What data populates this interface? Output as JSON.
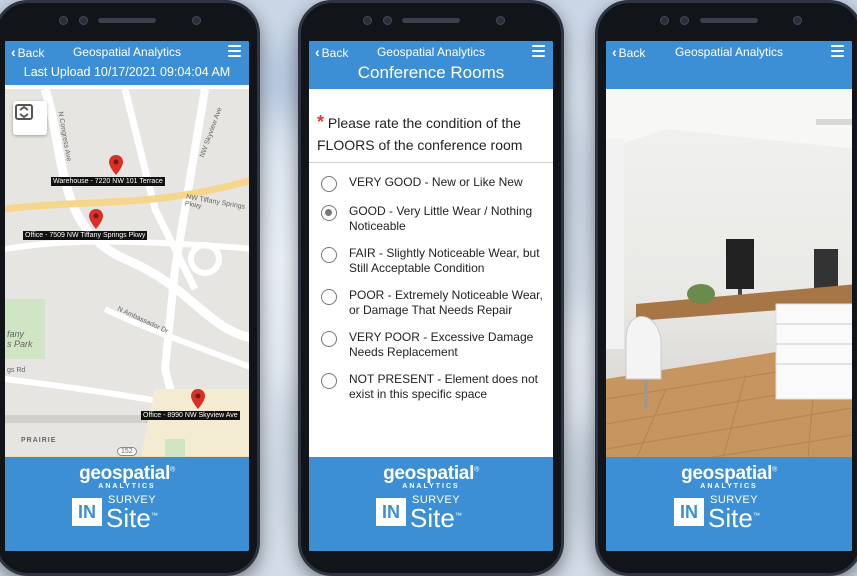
{
  "phones": [
    {
      "header": {
        "back_label": "Back",
        "app_title": "Geospatial Analytics",
        "subtitle": "Last Upload 10/17/2021 09:04:04 AM"
      },
      "map": {
        "pins": [
          {
            "label": "Warehouse - 7220 NW 101 Terrace"
          },
          {
            "label": "Office - 7509 NW Tiffany Springs Pkwy"
          },
          {
            "label": "Office - 8990 NW Skyview Ave"
          }
        ],
        "streets": [
          "N Congress Ave",
          "NW Skyview Ave",
          "N Ambassador Dr",
          "NW Tiffany Springs Pkwy",
          "fany\ns Park",
          "gs Rd",
          "PRAIRIE",
          "152"
        ],
        "icons": [
          "expand-map-icon"
        ]
      }
    },
    {
      "header": {
        "back_label": "Back",
        "app_title": "Geospatial Analytics",
        "title": "Conference Rooms"
      },
      "question": {
        "required_mark": "*",
        "text": "Please rate the condition of the FLOORS of the conference room"
      },
      "options": [
        {
          "label": "VERY GOOD - New or Like New",
          "selected": false
        },
        {
          "label": "GOOD - Very Little Wear / Nothing Noticeable",
          "selected": true
        },
        {
          "label": "FAIR - Slightly Noticeable Wear, but Still Acceptable Condition",
          "selected": false
        },
        {
          "label": "POOR - Extremely Noticeable Wear, or Damage That Needs Repair",
          "selected": false
        },
        {
          "label": "VERY POOR - Excessive Damage Needs Replacement",
          "selected": false
        },
        {
          "label": "NOT PRESENT - Element does not exist in this specific space",
          "selected": false
        }
      ]
    },
    {
      "header": {
        "back_label": "Back",
        "app_title": "Geospatial Analytics"
      }
    }
  ],
  "footer": {
    "brand": "geospatial",
    "brand_sub": "ANALYTICS",
    "in": "IN",
    "survey": "SURVEY",
    "site": "Site",
    "tm": "™"
  },
  "colors": {
    "accent": "#3c8fd5",
    "pin": "#d93025",
    "required": "#e33333"
  }
}
